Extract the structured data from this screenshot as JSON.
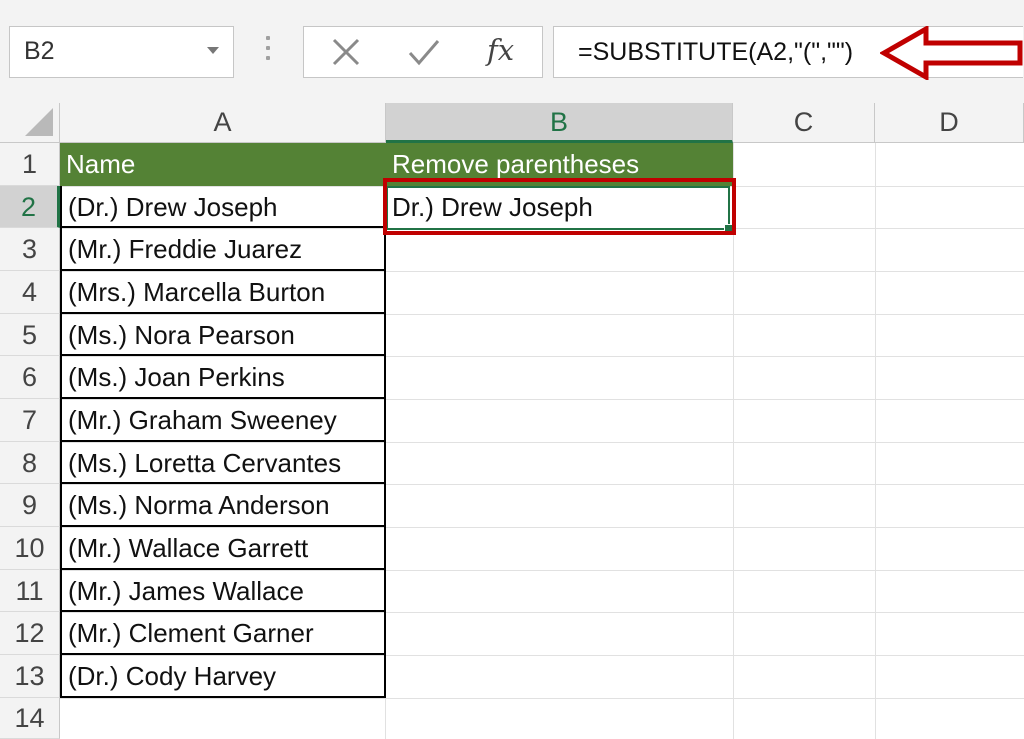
{
  "formula_bar": {
    "name_box": "B2",
    "formula": "=SUBSTITUTE(A2,\"(\",\"\")",
    "fx_label": "fx",
    "icons": [
      "cancel-x-icon",
      "confirm-check-icon",
      "insert-function-icon"
    ]
  },
  "columns": [
    "A",
    "B",
    "C",
    "D"
  ],
  "rows": [
    "1",
    "2",
    "3",
    "4",
    "5",
    "6",
    "7",
    "8",
    "9",
    "10",
    "11",
    "12",
    "13",
    "14"
  ],
  "selected_cell": "B2",
  "header_fill_color": "#548235",
  "accent_color": "#217346",
  "highlight_color": "#c00000",
  "cells": {
    "A1": "Name",
    "B1": "Remove parentheses",
    "B2": "Dr.) Drew Joseph",
    "names": [
      "(Dr.) Drew Joseph",
      "(Mr.) Freddie Juarez",
      "(Mrs.) Marcella Burton",
      "(Ms.) Nora Pearson",
      "(Ms.) Joan Perkins",
      "(Mr.) Graham Sweeney",
      "(Ms.) Loretta Cervantes",
      "(Ms.) Norma Anderson",
      "(Mr.) Wallace Garrett",
      "(Mr.) James Wallace",
      "(Mr.) Clement Garner",
      "(Dr.) Cody Harvey"
    ]
  }
}
